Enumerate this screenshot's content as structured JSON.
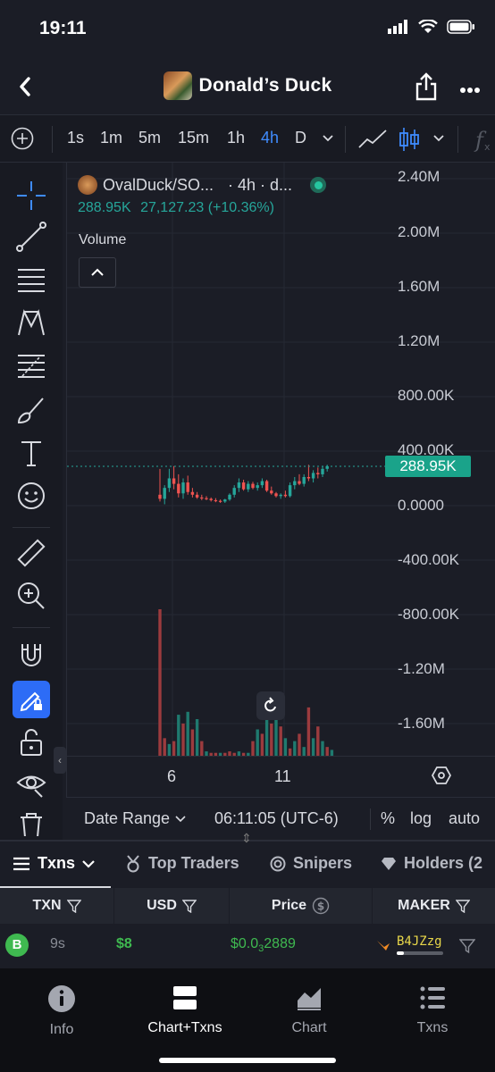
{
  "status_bar": {
    "time": "19:11"
  },
  "header": {
    "title": "Donald’s Duck"
  },
  "toolbar": {
    "timeframes": [
      "1s",
      "1m",
      "5m",
      "15m",
      "1h",
      "4h",
      "D"
    ],
    "active_timeframe": "4h"
  },
  "legend": {
    "symbol": "OvalDuck/SO...",
    "interval": "· 4h · d...",
    "last_value": "288.95K",
    "change": "27,127.23 (+10.36%)",
    "volume_label": "Volume"
  },
  "y_axis": [
    "2.40M",
    "2.00M",
    "1.60M",
    "1.20M",
    "800.00K",
    "400.00K",
    "0.0000",
    "-400.00K",
    "-800.00K",
    "-1.20M",
    "-1.60M"
  ],
  "price_tag": "288.95K",
  "x_axis": [
    "6",
    "11"
  ],
  "range_bar": {
    "date_range": "Date Range",
    "time": "06:11:05 (UTC-6)",
    "percent": "%",
    "log": "log",
    "auto": "auto"
  },
  "txn_tabs": [
    "Txns",
    "Top Traders",
    "Snipers",
    "Holders (2"
  ],
  "table": {
    "headers": [
      "TXN",
      "USD",
      "Price",
      "MAKER"
    ],
    "rows": [
      {
        "type": "B",
        "age": "9s",
        "usd": "$8",
        "price_prefix": "$0.0",
        "price_sub": "3",
        "price_rest": "2889",
        "maker": "B4JZzg"
      }
    ]
  },
  "bottom_nav": [
    "Info",
    "Chart+Txns",
    "Chart",
    "Txns"
  ],
  "colors": {
    "up": "#26a69a",
    "down": "#ef5350",
    "accent": "#2d6cf6",
    "buy": "#3fb950"
  },
  "chart_data": {
    "type": "candlestick",
    "y_range": [
      -1600000,
      2400000
    ],
    "last_price": 288950,
    "price_series": [
      {
        "o": 80000,
        "h": 270000,
        "l": 30000,
        "c": 50000
      },
      {
        "o": 50000,
        "h": 150000,
        "l": 10000,
        "c": 130000
      },
      {
        "o": 130000,
        "h": 270000,
        "l": 100000,
        "c": 200000
      },
      {
        "o": 200000,
        "h": 290000,
        "l": 120000,
        "c": 160000
      },
      {
        "o": 160000,
        "h": 230000,
        "l": 60000,
        "c": 90000
      },
      {
        "o": 90000,
        "h": 200000,
        "l": 50000,
        "c": 170000
      },
      {
        "o": 170000,
        "h": 220000,
        "l": 80000,
        "c": 100000
      },
      {
        "o": 100000,
        "h": 130000,
        "l": 60000,
        "c": 80000
      },
      {
        "o": 80000,
        "h": 100000,
        "l": 50000,
        "c": 60000
      },
      {
        "o": 60000,
        "h": 80000,
        "l": 40000,
        "c": 55000
      },
      {
        "o": 55000,
        "h": 70000,
        "l": 40000,
        "c": 50000
      },
      {
        "o": 50000,
        "h": 60000,
        "l": 30000,
        "c": 40000
      },
      {
        "o": 40000,
        "h": 55000,
        "l": 25000,
        "c": 35000
      },
      {
        "o": 35000,
        "h": 45000,
        "l": 20000,
        "c": 30000
      },
      {
        "o": 30000,
        "h": 50000,
        "l": 20000,
        "c": 45000
      },
      {
        "o": 45000,
        "h": 90000,
        "l": 35000,
        "c": 80000
      },
      {
        "o": 80000,
        "h": 150000,
        "l": 60000,
        "c": 130000
      },
      {
        "o": 130000,
        "h": 200000,
        "l": 100000,
        "c": 170000
      },
      {
        "o": 170000,
        "h": 190000,
        "l": 110000,
        "c": 120000
      },
      {
        "o": 120000,
        "h": 180000,
        "l": 100000,
        "c": 160000
      },
      {
        "o": 160000,
        "h": 175000,
        "l": 120000,
        "c": 130000
      },
      {
        "o": 130000,
        "h": 170000,
        "l": 110000,
        "c": 150000
      },
      {
        "o": 150000,
        "h": 200000,
        "l": 130000,
        "c": 180000
      },
      {
        "o": 180000,
        "h": 190000,
        "l": 100000,
        "c": 110000
      },
      {
        "o": 110000,
        "h": 140000,
        "l": 80000,
        "c": 90000
      },
      {
        "o": 90000,
        "h": 100000,
        "l": 60000,
        "c": 70000
      },
      {
        "o": 70000,
        "h": 90000,
        "l": 50000,
        "c": 80000
      },
      {
        "o": 80000,
        "h": 110000,
        "l": 60000,
        "c": 70000
      },
      {
        "o": 70000,
        "h": 170000,
        "l": 60000,
        "c": 150000
      },
      {
        "o": 150000,
        "h": 210000,
        "l": 120000,
        "c": 180000
      },
      {
        "o": 180000,
        "h": 230000,
        "l": 150000,
        "c": 160000
      },
      {
        "o": 160000,
        "h": 230000,
        "l": 140000,
        "c": 210000
      },
      {
        "o": 210000,
        "h": 300000,
        "l": 180000,
        "c": 200000
      },
      {
        "o": 200000,
        "h": 260000,
        "l": 170000,
        "c": 240000
      },
      {
        "o": 240000,
        "h": 280000,
        "l": 200000,
        "c": 230000
      },
      {
        "o": 230000,
        "h": 290000,
        "l": 210000,
        "c": 270000
      },
      {
        "o": 270000,
        "h": 300000,
        "l": 250000,
        "c": 289000
      }
    ],
    "volume_series": [
      {
        "v": 1.0,
        "up": false
      },
      {
        "v": 0.12,
        "up": false
      },
      {
        "v": 0.08,
        "up": true
      },
      {
        "v": 0.1,
        "up": false
      },
      {
        "v": 0.28,
        "up": true
      },
      {
        "v": 0.22,
        "up": false
      },
      {
        "v": 0.3,
        "up": true
      },
      {
        "v": 0.18,
        "up": false
      },
      {
        "v": 0.25,
        "up": true
      },
      {
        "v": 0.1,
        "up": false
      },
      {
        "v": 0.03,
        "up": true
      },
      {
        "v": 0.02,
        "up": false
      },
      {
        "v": 0.02,
        "up": false
      },
      {
        "v": 0.02,
        "up": true
      },
      {
        "v": 0.02,
        "up": false
      },
      {
        "v": 0.03,
        "up": false
      },
      {
        "v": 0.02,
        "up": false
      },
      {
        "v": 0.03,
        "up": true
      },
      {
        "v": 0.02,
        "up": false
      },
      {
        "v": 0.02,
        "up": true
      },
      {
        "v": 0.1,
        "up": false
      },
      {
        "v": 0.18,
        "up": true
      },
      {
        "v": 0.15,
        "up": false
      },
      {
        "v": 0.3,
        "up": true
      },
      {
        "v": 0.22,
        "up": false
      },
      {
        "v": 0.28,
        "up": true
      },
      {
        "v": 0.2,
        "up": false
      },
      {
        "v": 0.12,
        "up": true
      },
      {
        "v": 0.05,
        "up": false
      },
      {
        "v": 0.1,
        "up": true
      },
      {
        "v": 0.15,
        "up": false
      },
      {
        "v": 0.06,
        "up": true
      },
      {
        "v": 0.33,
        "up": false
      },
      {
        "v": 0.12,
        "up": true
      },
      {
        "v": 0.2,
        "up": false
      },
      {
        "v": 0.1,
        "up": true
      },
      {
        "v": 0.06,
        "up": false
      },
      {
        "v": 0.04,
        "up": true
      }
    ]
  }
}
